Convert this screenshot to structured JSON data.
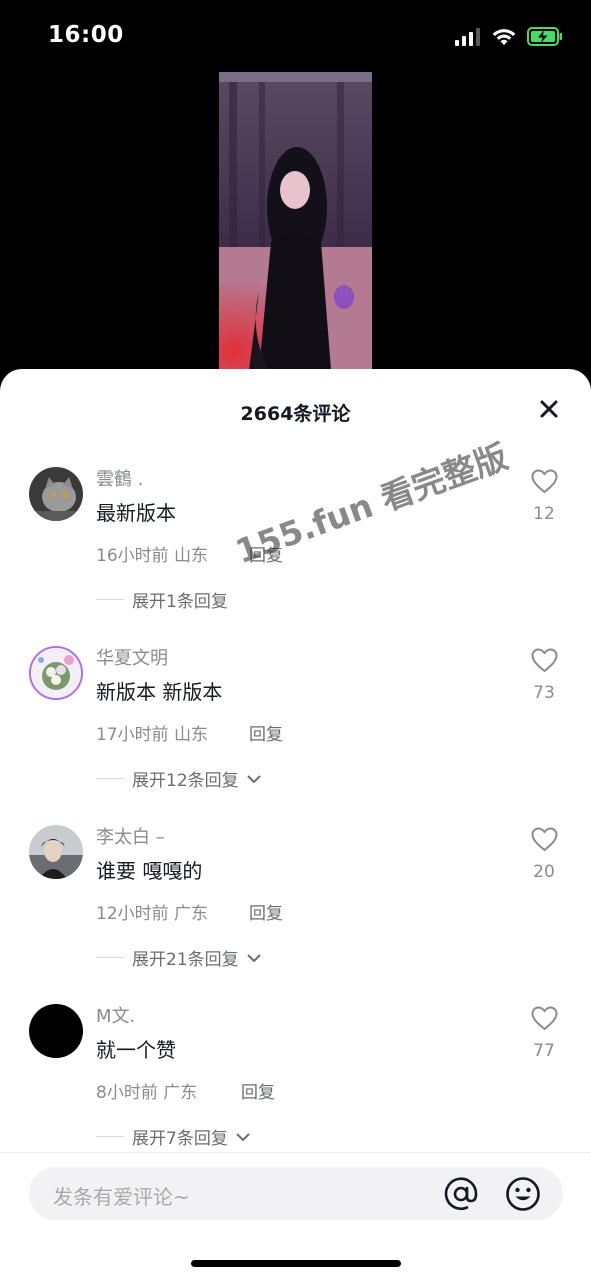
{
  "status_bar": {
    "time": "16:00"
  },
  "comments_sheet": {
    "title": "2664条评论",
    "watermark": "155.fun 看完整版",
    "reply_label": "回复",
    "comments": [
      {
        "username": "雲鶴 .",
        "text": "最新版本",
        "time_location": "16小时前 山东",
        "likes": "12",
        "expand": "展开1条回复"
      },
      {
        "username": "华夏文明",
        "text": "新版本 新版本",
        "time_location": "17小时前 山东",
        "likes": "73",
        "expand": "展开12条回复"
      },
      {
        "username": "李太白 –",
        "text": "谁要 嘎嘎的",
        "time_location": "12小时前 广东",
        "likes": "20",
        "expand": "展开21条回复"
      },
      {
        "username": "M文.",
        "text": "就一个赞",
        "time_location": "8小时前 广东",
        "likes": "77",
        "expand": "展开7条回复"
      }
    ],
    "input": {
      "placeholder": "发条有爱评论~"
    }
  }
}
